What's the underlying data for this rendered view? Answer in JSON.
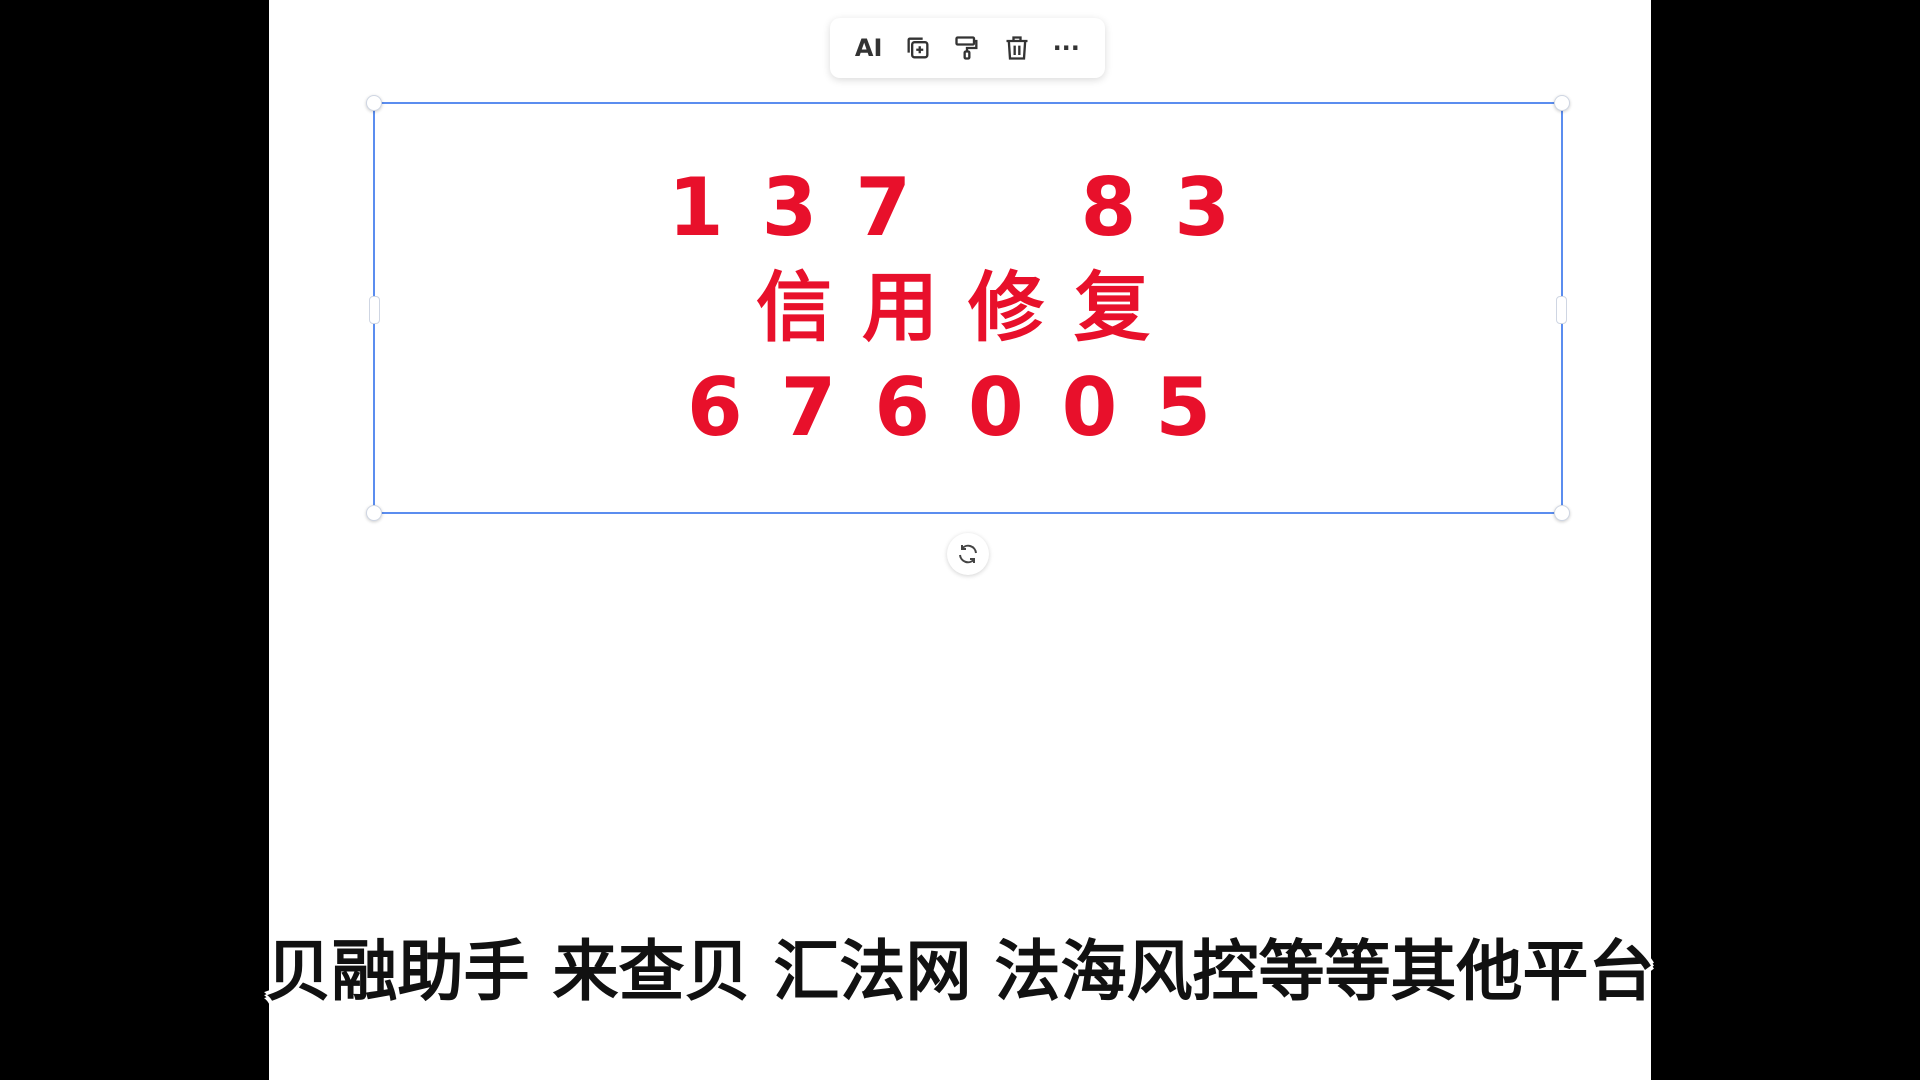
{
  "toolbar": {
    "ai_label": "AI",
    "icons": [
      "copy-add-icon",
      "format-painter-icon",
      "trash-icon",
      "more-icon"
    ],
    "more_label": "···"
  },
  "text_box": {
    "line1": "137  83",
    "line2": "信用修复",
    "line3": "676005",
    "color": "#e8102b",
    "selection_color": "#5b8def"
  },
  "subtitle": "贝融助手 来查贝 汇法网 法海风控等等其他平台"
}
